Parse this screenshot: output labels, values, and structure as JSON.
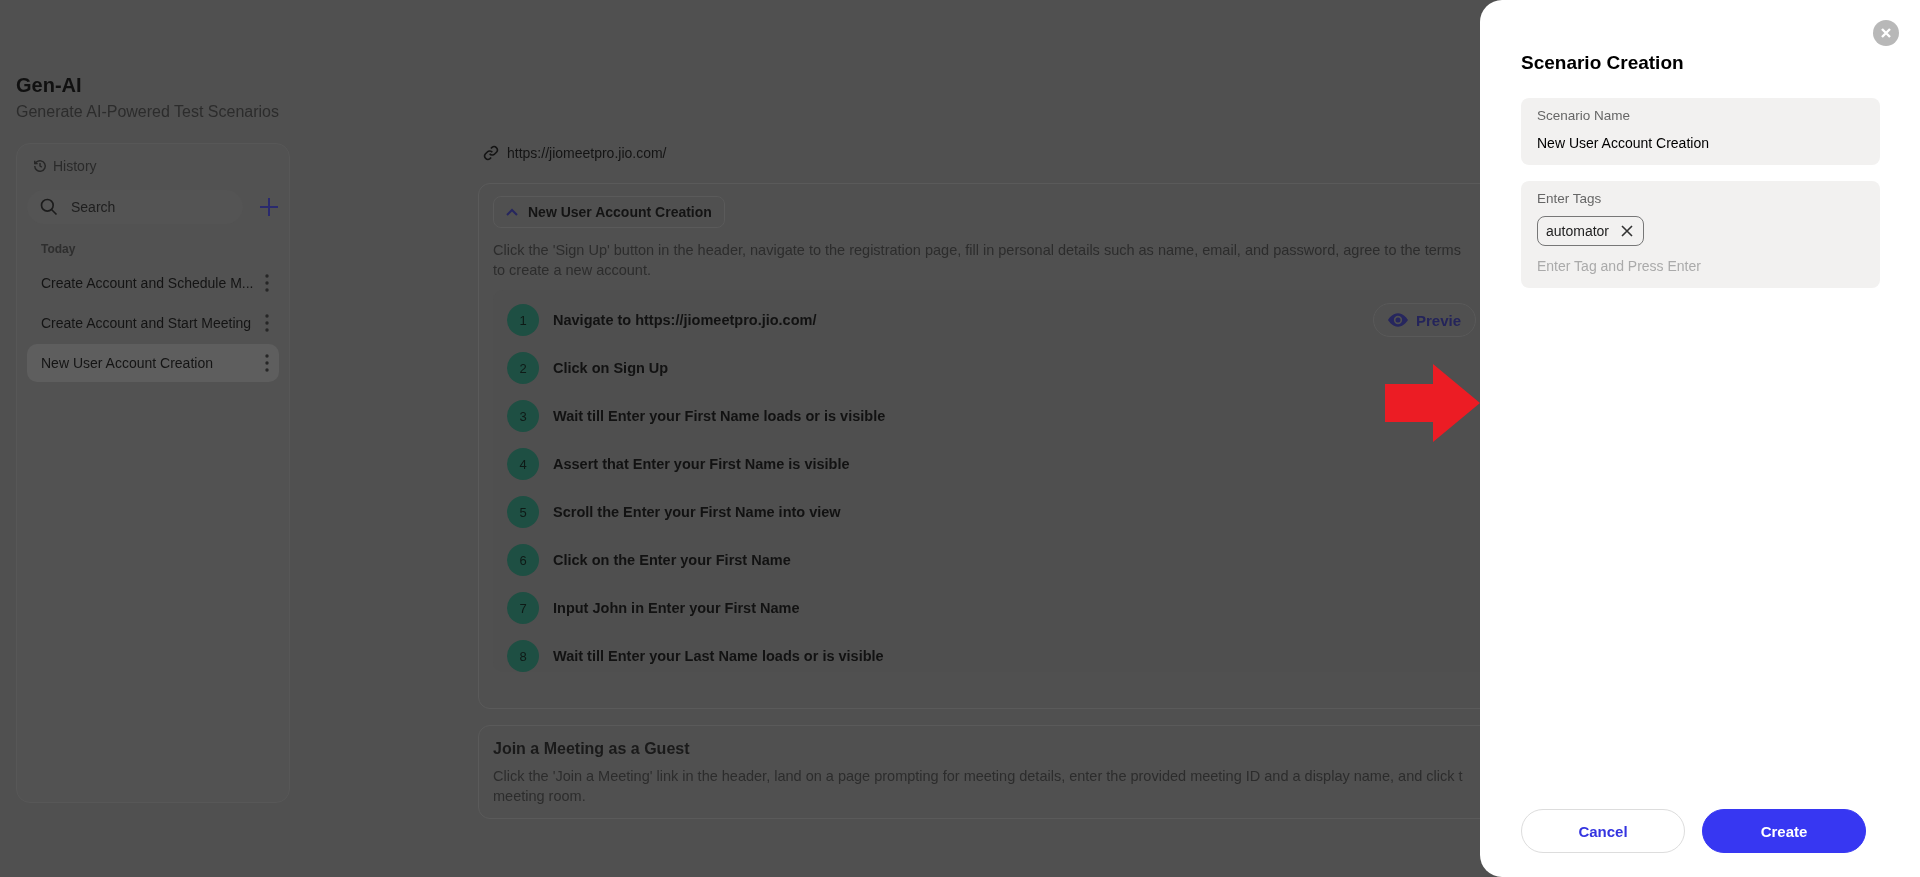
{
  "header": {
    "title": "Gen-AI",
    "subtitle": "Generate AI-Powered Test Scenarios"
  },
  "sidebar": {
    "title": "History",
    "search": {
      "placeholder": "Search"
    },
    "group": "Today",
    "items": [
      {
        "label": "Create Account and Schedule M...",
        "selected": false
      },
      {
        "label": "Create Account and Start Meeting",
        "selected": false
      },
      {
        "label": "New User Account Creation",
        "selected": true
      }
    ]
  },
  "main": {
    "url": "https://jiomeetpro.jio.com/",
    "scenarios": [
      {
        "title": "New User Account Creation",
        "expanded": true,
        "description_lines": [
          "Click the 'Sign Up' button in the header, navigate to the registration page, fill in personal details such as name, email, and password, agree to the terms",
          "to create a new account."
        ],
        "preview_button": "Previe",
        "steps": [
          {
            "number": "1",
            "text": "Navigate to https://jiomeetpro.jio.com/"
          },
          {
            "number": "2",
            "text": "Click on Sign Up"
          },
          {
            "number": "3",
            "text": "Wait till Enter your First Name loads or is visible"
          },
          {
            "number": "4",
            "text": "Assert that Enter your First Name is visible"
          },
          {
            "number": "5",
            "text": "Scroll the Enter your First Name into view"
          },
          {
            "number": "6",
            "text": "Click on the Enter your First Name"
          },
          {
            "number": "7",
            "text": "Input John in Enter your First Name"
          },
          {
            "number": "8",
            "text": "Wait till Enter your Last Name loads or is visible"
          }
        ]
      },
      {
        "title": "Join a Meeting as a Guest",
        "expanded": false,
        "description_lines": [
          "Click the 'Join a Meeting' link in the header, land on a page prompting for meeting details, enter the provided meeting ID and a display name, and click t",
          "meeting room."
        ]
      }
    ]
  },
  "drawer": {
    "title": "Scenario Creation",
    "name_field": {
      "label": "Scenario Name",
      "value": "New User Account Creation"
    },
    "tags_field": {
      "label": "Enter Tags",
      "tags": [
        "automator"
      ],
      "placeholder": "Enter Tag and Press Enter"
    },
    "buttons": [
      {
        "label": "Cancel",
        "kind": "secondary"
      },
      {
        "label": "Create",
        "kind": "primary"
      }
    ]
  }
}
